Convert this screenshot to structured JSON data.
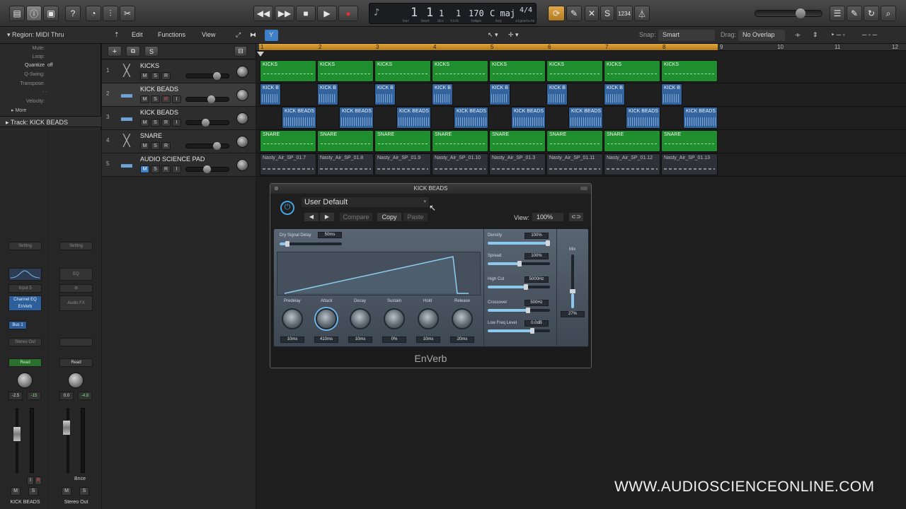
{
  "control_bar": {
    "lcd": {
      "bar": "1",
      "beat": "1",
      "div": "1",
      "tick": "1",
      "tempo": "170",
      "key": "C maj",
      "signature": "4/4",
      "labels": [
        "bar",
        "beat",
        "div",
        "tick",
        "tempo",
        "key",
        "signature"
      ]
    },
    "count_in": "1234"
  },
  "sub_bar": {
    "region_label": "Region: MIDI Thru",
    "menus": [
      "Edit",
      "Functions",
      "View"
    ],
    "snap_label": "Snap:",
    "snap_value": "Smart",
    "drag_label": "Drag:",
    "drag_value": "No Overlap"
  },
  "inspector": {
    "rows": [
      {
        "label": "Mute:",
        "value": ""
      },
      {
        "label": "Loop:",
        "value": ""
      },
      {
        "label": "Quantize",
        "value": "off"
      },
      {
        "label": "Q-Swing:",
        "value": ""
      },
      {
        "label": "Transpose:",
        "value": ""
      },
      {
        "label": "",
        "value": "- -"
      },
      {
        "label": "Velocity:",
        "value": ""
      }
    ],
    "more": "More",
    "track_label": "Track:  KICK BEADS",
    "strips": [
      {
        "setting": "Setting",
        "eq": "",
        "input": "Input 5",
        "insert": "Channel EQ\nEnVerb",
        "send": "Bus 1",
        "output": "Stereo Out",
        "auto": "Read",
        "vol": "-2.5",
        "peak": "-15",
        "name": "KICK BEADS",
        "m": "M",
        "s": "S",
        "i": "I",
        "r": "R"
      },
      {
        "setting": "Setting",
        "eq": "EQ",
        "input": "",
        "insert": "Audio FX",
        "send": "",
        "output": "",
        "auto": "Read",
        "vol": "0.0",
        "peak": "-4.8",
        "name": "Stereo Out",
        "m": "M",
        "s": "S",
        "bnce": "Bnce"
      }
    ]
  },
  "track_buttons": {
    "add": "+",
    "s": "S"
  },
  "tracks": [
    {
      "num": "1",
      "name": "KICKS",
      "type": "drum",
      "buttons": [
        "M",
        "S",
        "R"
      ]
    },
    {
      "num": "2",
      "name": "KICK BEADS",
      "type": "audio",
      "buttons": [
        "M",
        "S",
        "R",
        "I"
      ]
    },
    {
      "num": "3",
      "name": "KICK BEADS",
      "type": "audio",
      "buttons": [
        "M",
        "S",
        "R",
        "I"
      ]
    },
    {
      "num": "4",
      "name": "SNARE",
      "type": "drum",
      "buttons": [
        "M",
        "S",
        "R"
      ]
    },
    {
      "num": "5",
      "name": "AUDIO SCIENCE PAD",
      "type": "audio",
      "buttons": [
        "M",
        "S",
        "R",
        "I"
      ]
    }
  ],
  "ruler": [
    "1",
    "2",
    "3",
    "4",
    "5",
    "6",
    "7",
    "8",
    "9",
    "10",
    "11",
    "12"
  ],
  "lanes": [
    {
      "color": "green",
      "regions": [
        "KICKS",
        "KICKS",
        "KICKS",
        "KICKS",
        "KICKS",
        "KICKS",
        "KICKS",
        "KICKS"
      ]
    },
    {
      "color": "blue",
      "regions": [
        "KICK B",
        "KICK B",
        "KICK B",
        "KICK B",
        "KICK B",
        "KICK B",
        "KICK B",
        "KICK B"
      ]
    },
    {
      "color": "blue",
      "regions": [
        "KICK BEADS",
        "KICK BEADS",
        "KICK BEADS",
        "KICK BEADS",
        "KICK BEADS",
        "KICK BEADS",
        "KICK BEADS",
        "KICK BEADS"
      ]
    },
    {
      "color": "green",
      "regions": [
        "SNARE",
        "SNARE",
        "SNARE",
        "SNARE",
        "SNARE",
        "SNARE",
        "SNARE",
        "SNARE"
      ]
    },
    {
      "color": "grey",
      "regions": [
        "Nasty_Air_SP_01.7",
        "Nasty_Air_SP_01.8",
        "Nasty_Air_SP_01.9",
        "Nasty_Air_SP_01.10",
        "Nasty_Air_SP_01.3",
        "Nasty_Air_SP_01.11",
        "Nasty_Air_SP_01.12",
        "Nasty_Air_SP_01.13"
      ]
    }
  ],
  "plugin": {
    "title": "KICK BEADS",
    "preset": "User Default",
    "compare": "Compare",
    "copy": "Copy",
    "paste": "Paste",
    "view_label": "View:",
    "view_value": "100%",
    "name": "EnVerb",
    "dry_delay": {
      "label": "Dry Signal Delay",
      "value": "50ms"
    },
    "envelope_knobs": [
      {
        "label": "Predelay",
        "value": "10ms"
      },
      {
        "label": "Attack",
        "value": "410ms"
      },
      {
        "label": "Decay",
        "value": "10ms"
      },
      {
        "label": "Sustain",
        "value": "0%"
      },
      {
        "label": "Hold",
        "value": "10ms"
      },
      {
        "label": "Release",
        "value": "20ms"
      }
    ],
    "right_params": [
      {
        "label": "Density",
        "value": "100%",
        "level": 1.0
      },
      {
        "label": "Spread",
        "value": "100%",
        "level": 0.55
      },
      {
        "label": "High Cut",
        "value": "5000Hz",
        "level": 0.65
      },
      {
        "label": "Crossover",
        "value": "500Hz",
        "level": 0.68
      },
      {
        "label": "Low Freq Level",
        "value": "0.0dB",
        "level": 0.75
      }
    ],
    "mix": {
      "label": "Mix",
      "value": "27%"
    }
  },
  "watermark": "WWW.AUDIOSCIENCEONLINE.COM"
}
